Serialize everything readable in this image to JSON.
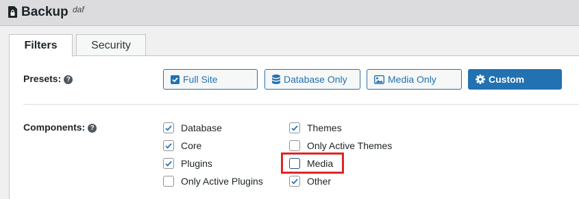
{
  "header": {
    "title": "Backup",
    "subtitle": "daf",
    "icon": "file-lock-icon"
  },
  "tabs": [
    {
      "label": "Filters",
      "active": true
    },
    {
      "label": "Security",
      "active": false
    }
  ],
  "presets": {
    "label": "Presets:",
    "items": [
      {
        "label": "Full Site",
        "icon": "checkbox-icon",
        "active": false
      },
      {
        "label": "Database Only",
        "icon": "database-icon",
        "active": false
      },
      {
        "label": "Media Only",
        "icon": "image-icon",
        "active": false
      },
      {
        "label": "Custom",
        "icon": "gear-icon",
        "active": true
      }
    ]
  },
  "components": {
    "label": "Components:",
    "items": [
      {
        "label": "Database",
        "checked": true
      },
      {
        "label": "Core",
        "checked": true
      },
      {
        "label": "Plugins",
        "checked": true
      },
      {
        "label": "Only Active Plugins",
        "checked": false
      },
      {
        "label": "Themes",
        "checked": true
      },
      {
        "label": "Only Active Themes",
        "checked": false
      },
      {
        "label": "Media",
        "checked": false,
        "highlighted": true
      },
      {
        "label": "Other",
        "checked": true
      }
    ]
  },
  "colors": {
    "accent": "#2271b1",
    "highlight": "#e02424"
  }
}
